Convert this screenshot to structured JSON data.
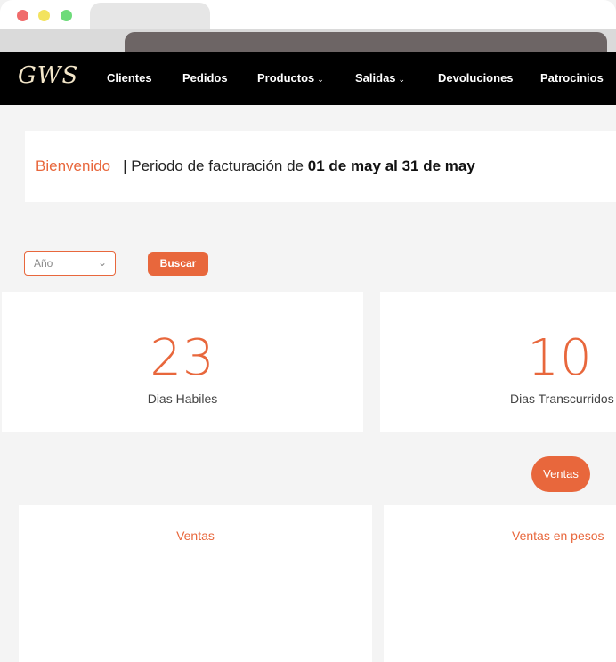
{
  "nav": {
    "logo": "GWS",
    "items": [
      {
        "label": "Clientes",
        "dropdown": false
      },
      {
        "label": "Pedidos",
        "dropdown": false
      },
      {
        "label": "Productos",
        "dropdown": true
      },
      {
        "label": "Salidas",
        "dropdown": true
      },
      {
        "label": "Devoluciones",
        "dropdown": false
      },
      {
        "label": "Patrocinios",
        "dropdown": false
      }
    ]
  },
  "welcome": {
    "greeting": "Bienvenido",
    "period_prefix": "| Periodo de facturación de",
    "period_range": "01 de may al 31 de may"
  },
  "filters": {
    "year_select": "Año",
    "search_button": "Buscar"
  },
  "stats": [
    {
      "value": "23",
      "label": "Dias Habiles"
    },
    {
      "value": "10",
      "label": "Dias Transcurridos"
    }
  ],
  "actions": {
    "ventas_button": "Ventas"
  },
  "panels": [
    {
      "title": "Ventas"
    },
    {
      "title": "Ventas en pesos"
    }
  ],
  "colors": {
    "accent": "#e8673c",
    "nav_bg": "#000000",
    "page_bg": "#f4f4f4"
  }
}
